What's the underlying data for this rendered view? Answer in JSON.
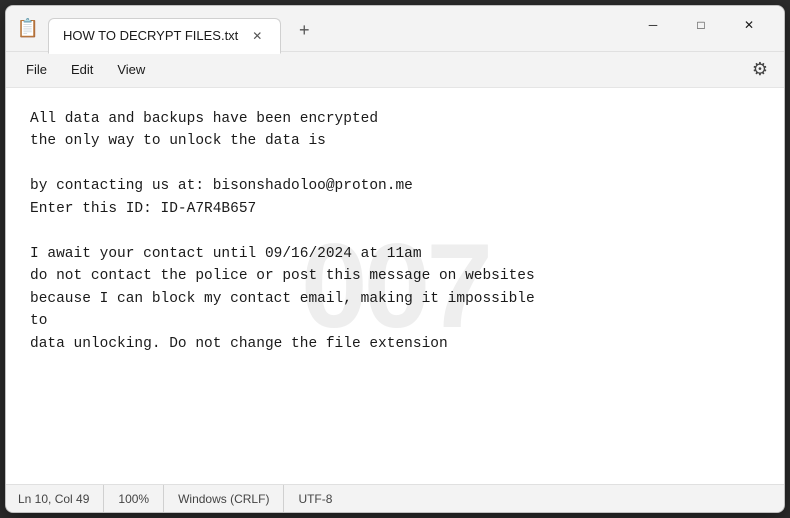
{
  "window": {
    "title": "HOW TO DECRYPT FILES.txt",
    "icon": "📋"
  },
  "controls": {
    "minimize": "─",
    "maximize": "□",
    "close": "✕",
    "add_tab": "+",
    "tab_close": "✕"
  },
  "menu": {
    "items": [
      "File",
      "Edit",
      "View"
    ],
    "gear_label": "⚙"
  },
  "content": {
    "text": "All data and backups have been encrypted\nthe only way to unlock the data is\n\nby contacting us at: bisonshadoloo@proton.me\nEnter this ID: ID-A7R4B657\n\nI await your contact until 09/16/2024 at 11am\ndo not contact the police or post this message on websites\nbecause I can block my contact email, making it impossible\nto\ndata unlocking. Do not change the file extension",
    "watermark": "007"
  },
  "statusbar": {
    "position": "Ln 10, Col 49",
    "zoom": "100%",
    "line_ending": "Windows (CRLF)",
    "encoding": "UTF-8"
  }
}
